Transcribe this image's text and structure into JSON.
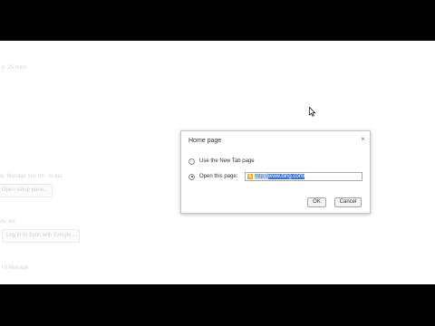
{
  "background": {
    "line1": "y: 25 mins",
    "line2": "w. Manage you un . tu pla",
    "button1": "Open setup pane...",
    "line3": "Ac acc",
    "button2": "Log in to Sync with Google...",
    "line4": "HI Manage"
  },
  "dialog": {
    "title": "Home page",
    "option_new_tab": "Use the New Tab page",
    "option_open_page": "Open this page:",
    "url_prefix": "http://",
    "url_selected": "www.bing.com/",
    "ok_label": "OK",
    "cancel_label": "Cancel",
    "selected_option": "open_page"
  },
  "colors": {
    "selection": "#3875d7",
    "favicon": "#f5a623",
    "letterbox": "#000000"
  }
}
